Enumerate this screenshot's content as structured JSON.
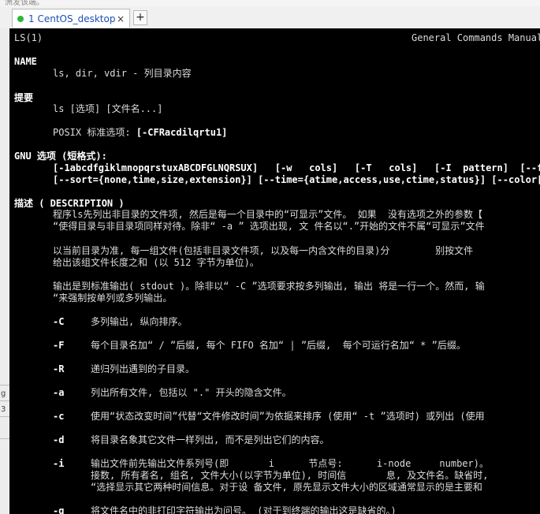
{
  "window": {
    "top_fragment": "洲发该端。",
    "tab_label": "1 CentOS_desktop",
    "tab_close": "×",
    "new_tab": "+",
    "side_marks": [
      "g",
      "3"
    ]
  },
  "man": {
    "header_left": "LS(1)",
    "header_right": "General Commands Manual",
    "name_h": "NAME",
    "name_body": "ls, dir, vdir - 列目录内容",
    "synopsis_h": "提要",
    "synopsis_body": "ls [选项] [文件名...]",
    "posix_label": "POSIX 标准选项: ",
    "posix_opts": "[-CFRacdilqrtu1]",
    "gnu_h": "GNU 选项 (短格式):",
    "gnu_line1": "[-1abcdfgiklmnopqrstuxABCDFGLNQRSUX]   [-w   cols]   [-T   cols]   [-I  pattern]  [--ful",
    "gnu_line2": "[--sort={none,time,size,extension}] [--time={atime,access,use,ctime,status}] [--color[={",
    "desc_h": "描述 ( DESCRIPTION )",
    "desc_p1_l1": "程序ls先列出非目录的文件项, 然后是每一个目录中的“可显示”文件。 如果  没有选项之外的参数【",
    "desc_p1_l2": "“使得目录与非目录项同样对待。除非“ -a ” 选项出现, 文 件名以“.”开始的文件不属“可显示”文件",
    "desc_p2_l1": "以当前目录为准, 每一组文件(包括非目录文件项, 以及每一内含文件的目录)分        别按文件",
    "desc_p2_l2": "给出该组文件长度之和 (以 512 字节为单位)。",
    "desc_p3_l1": "输出是到标准输出( stdout )。除非以“ -C ”选项要求按多列输出, 输出 将是一行一个。然而, 输",
    "desc_p3_l2": "“来强制按单列或多列输出。",
    "options": [
      {
        "flag": "-C",
        "text": "多列输出, 纵向排序。"
      },
      {
        "flag": "-F",
        "text": "每个目录名加“ / ”后缀, 每个 FIFO 名加“ | ”后缀,  每个可运行名加“ * ”后缀。"
      },
      {
        "flag": "-R",
        "text": "递归列出遇到的子目录。"
      },
      {
        "flag": "-a",
        "text": "列出所有文件, 包括以 \".\" 开头的隐含文件。"
      },
      {
        "flag": "-c",
        "text": "使用“状态改变时间”代替“文件修改时间”为依据来排序 (使用“ -t ”选项时) 或列出 (使用"
      },
      {
        "flag": "-d",
        "text": "将目录名象其它文件一样列出, 而不是列出它们的内容。"
      },
      {
        "flag": "-i",
        "text": "输出文件前先输出文件系列号(即       i      节点号:      i-node     number)。"
      },
      {
        "flag": "-q",
        "text": "将文件名中的非打印字符输出为问号。 (对于到终端的输出这是缺省的。)"
      }
    ],
    "opt_i_l2": "接数, 所有者名, 组名, 文件大小(以字节为单位), 时间信       息, 及文件名。缺省时,",
    "opt_i_l3": "“选择显示其它两种时间信息。对于设 备文件, 原先显示文件大小的区域通常显示的是主要和"
  }
}
